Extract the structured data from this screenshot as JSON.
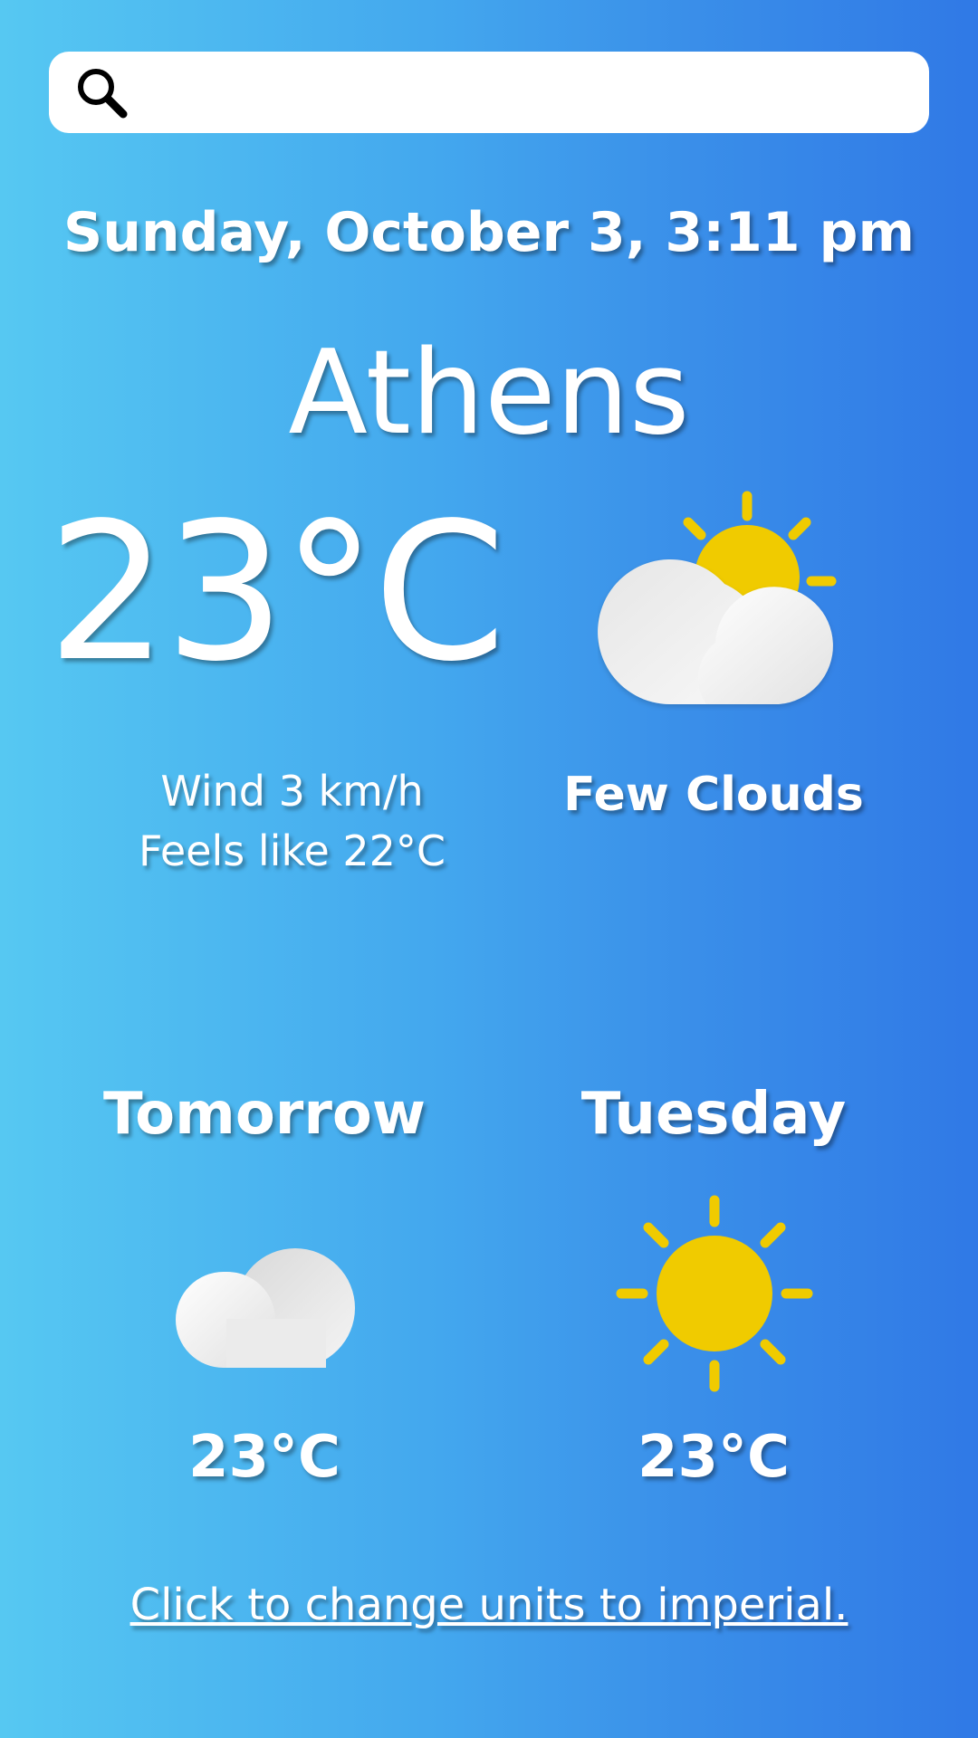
{
  "search": {
    "placeholder": "",
    "value": "",
    "icon": "search-icon"
  },
  "current": {
    "datetime": "Sunday, October 3, 3:11 pm",
    "city": "Athens",
    "temperature": "23°C",
    "icon": "few-clouds-icon",
    "wind": "Wind 3 km/h",
    "feels_like": "Feels like 22°C",
    "condition": "Few Clouds"
  },
  "forecast": [
    {
      "day": "Tomorrow",
      "icon": "cloud-icon",
      "temperature": "23°C"
    },
    {
      "day": "Tuesday",
      "icon": "sun-icon",
      "temperature": "23°C"
    }
  ],
  "footer": {
    "units_link": "Click to change units to imperial."
  },
  "colors": {
    "background_start": "#56c8f2",
    "background_end": "#3079e6",
    "sun": "#f0cb00",
    "cloud": "#f2f2f2",
    "text": "#ffffff"
  }
}
